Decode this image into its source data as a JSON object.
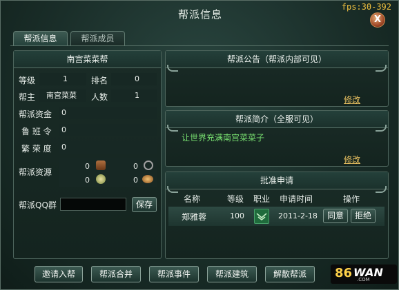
{
  "window": {
    "title": "帮派信息",
    "fps": "fps:30-392",
    "close_label": "X"
  },
  "tabs": [
    {
      "label": "帮派信息",
      "active": true
    },
    {
      "label": "帮派成员",
      "active": false
    }
  ],
  "info": {
    "header": "南宫菜菜帮",
    "level_label": "等级",
    "level_value": "1",
    "rank_label": "排名",
    "rank_value": "0",
    "leader_label": "帮主",
    "leader_value": "南宫菜菜",
    "members_label": "人数",
    "members_value": "1",
    "funds_label": "帮派资金",
    "funds_value": "0",
    "luban_label": "鲁 班 令",
    "luban_value": "0",
    "prosperity_label": "繁 荣 度",
    "prosperity_value": "0",
    "resources_label": "帮派资源",
    "resources": [
      {
        "icon": "wood-icon",
        "value": "0"
      },
      {
        "icon": "ore-icon",
        "value": "0"
      },
      {
        "icon": "gem-icon",
        "value": "0"
      },
      {
        "icon": "treasure-icon",
        "value": "0"
      }
    ],
    "qq_label": "帮派QQ群",
    "qq_value": "",
    "save_label": "保存"
  },
  "notice": {
    "header": "帮派公告（帮派内部可见）",
    "edit_label": "修改"
  },
  "intro": {
    "header": "帮派简介（全服可见）",
    "text": "让世界充满南宫菜菜子",
    "edit_label": "修改"
  },
  "approval": {
    "header": "批准申请",
    "columns": [
      "名称",
      "等级",
      "职业",
      "申请时间",
      "操作"
    ],
    "rows": [
      {
        "name": "郑雅蓉",
        "level": "100",
        "job_icon": "class-emblem-icon",
        "time": "2011-2-18",
        "approve": "同意",
        "reject": "拒绝"
      }
    ]
  },
  "bottom_buttons": [
    "邀请入帮",
    "帮派合并",
    "帮派事件",
    "帮派建筑",
    "解散帮派"
  ],
  "logo": {
    "number": "86",
    "word": "WAN",
    "domain": ".COM"
  },
  "colors": {
    "accent_gold": "#e8c060",
    "intro_green": "#78e070",
    "fps_yellow": "#f0c040"
  }
}
